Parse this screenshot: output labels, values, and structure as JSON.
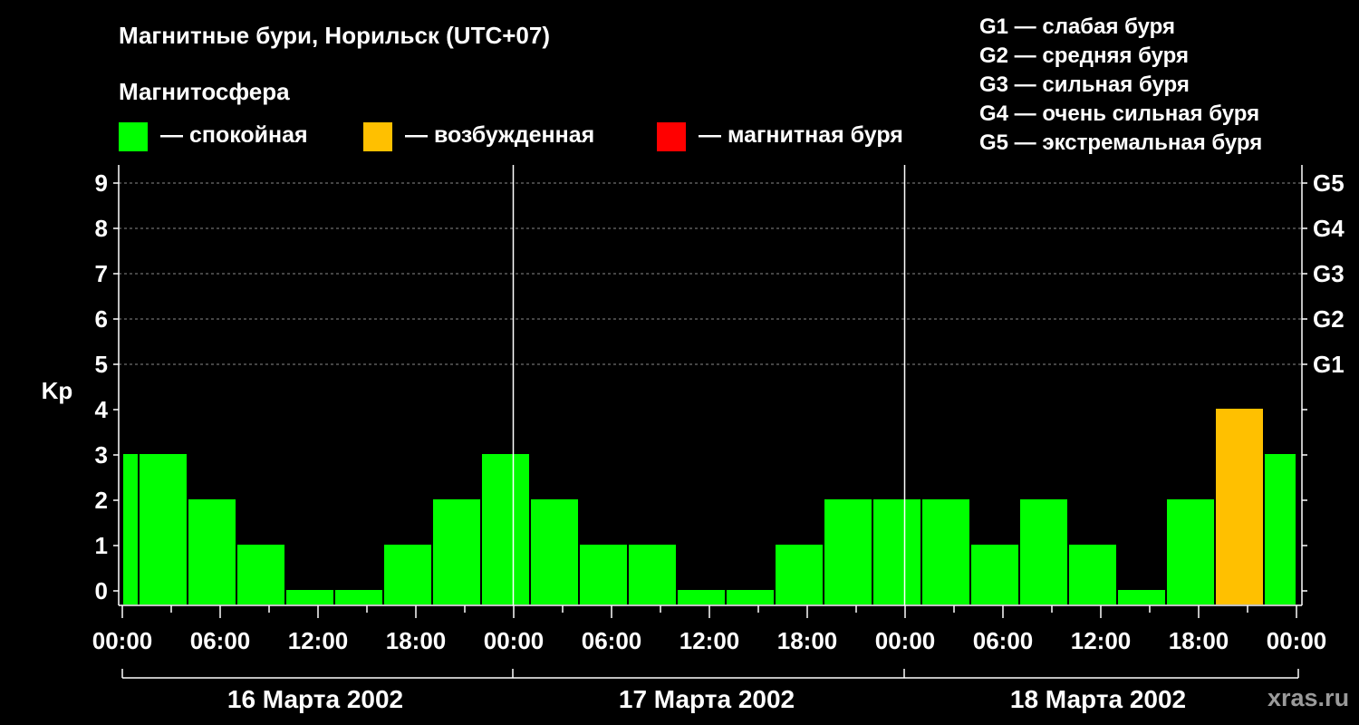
{
  "title": "Магнитные бури, Норильск (UTC+07)",
  "legend": {
    "heading": "Магнитосфера",
    "items": [
      {
        "color": "#00ff00",
        "label": "— спокойная"
      },
      {
        "color": "#ffc000",
        "label": "— возбужденная"
      },
      {
        "color": "#ff0000",
        "label": "— магнитная буря"
      }
    ]
  },
  "g_scale": [
    "G1 — слабая буря",
    "G2 — средняя буря",
    "G3 — сильная буря",
    "G4 — очень сильная буря",
    "G5 — экстремальная буря"
  ],
  "watermark": "xras.ru",
  "chart_data": {
    "type": "bar",
    "ylabel": "Kp",
    "ylim": [
      0,
      9
    ],
    "yticks": [
      0,
      1,
      2,
      3,
      4,
      5,
      6,
      7,
      8,
      9
    ],
    "right_ticks": [
      {
        "y": 5,
        "label": "G1"
      },
      {
        "y": 6,
        "label": "G2"
      },
      {
        "y": 7,
        "label": "G3"
      },
      {
        "y": 8,
        "label": "G4"
      },
      {
        "y": 9,
        "label": "G5"
      }
    ],
    "x_ticks": [
      "00:00",
      "06:00",
      "12:00",
      "18:00",
      "00:00",
      "06:00",
      "12:00",
      "18:00",
      "00:00",
      "06:00",
      "12:00",
      "18:00",
      "00:00"
    ],
    "days": [
      "16 Марта 2002",
      "17 Марта 2002",
      "18 Марта 2002"
    ],
    "grid": true,
    "colors": {
      "quiet": "#00ff00",
      "active": "#ffc000",
      "storm": "#ff0000"
    },
    "bars": [
      {
        "start": 0,
        "end": 1,
        "kp": 3,
        "level": "quiet"
      },
      {
        "start": 1,
        "end": 4,
        "kp": 3,
        "level": "quiet"
      },
      {
        "start": 4,
        "end": 7,
        "kp": 2,
        "level": "quiet"
      },
      {
        "start": 7,
        "end": 10,
        "kp": 1,
        "level": "quiet"
      },
      {
        "start": 10,
        "end": 13,
        "kp": 0,
        "level": "quiet"
      },
      {
        "start": 13,
        "end": 16,
        "kp": 0,
        "level": "quiet"
      },
      {
        "start": 16,
        "end": 19,
        "kp": 1,
        "level": "quiet"
      },
      {
        "start": 19,
        "end": 22,
        "kp": 2,
        "level": "quiet"
      },
      {
        "start": 22,
        "end": 25,
        "kp": 3,
        "level": "quiet"
      },
      {
        "start": 25,
        "end": 28,
        "kp": 2,
        "level": "quiet"
      },
      {
        "start": 28,
        "end": 31,
        "kp": 1,
        "level": "quiet"
      },
      {
        "start": 31,
        "end": 34,
        "kp": 1,
        "level": "quiet"
      },
      {
        "start": 34,
        "end": 37,
        "kp": 0,
        "level": "quiet"
      },
      {
        "start": 37,
        "end": 40,
        "kp": 0,
        "level": "quiet"
      },
      {
        "start": 40,
        "end": 43,
        "kp": 1,
        "level": "quiet"
      },
      {
        "start": 43,
        "end": 46,
        "kp": 2,
        "level": "quiet"
      },
      {
        "start": 46,
        "end": 49,
        "kp": 2,
        "level": "quiet"
      },
      {
        "start": 49,
        "end": 52,
        "kp": 2,
        "level": "quiet"
      },
      {
        "start": 52,
        "end": 55,
        "kp": 1,
        "level": "quiet"
      },
      {
        "start": 55,
        "end": 58,
        "kp": 2,
        "level": "quiet"
      },
      {
        "start": 58,
        "end": 61,
        "kp": 1,
        "level": "quiet"
      },
      {
        "start": 61,
        "end": 64,
        "kp": 0,
        "level": "quiet"
      },
      {
        "start": 64,
        "end": 67,
        "kp": 2,
        "level": "quiet"
      },
      {
        "start": 67,
        "end": 70,
        "kp": 4,
        "level": "active"
      },
      {
        "start": 70,
        "end": 72,
        "kp": 3,
        "level": "quiet"
      }
    ]
  }
}
